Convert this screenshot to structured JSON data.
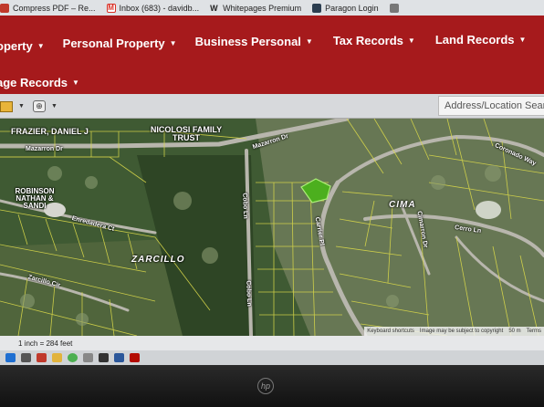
{
  "bookmarks": [
    {
      "label": "Compress PDF – Re...",
      "icon": "compress-pdf-icon",
      "color": "#c0392b"
    },
    {
      "label": "Inbox (683) - davidb...",
      "icon": "gmail-icon",
      "color": "#d93025"
    },
    {
      "label": "Whitepages Premium",
      "icon": "whitepages-icon",
      "color": "#222222"
    },
    {
      "label": "Paragon Login",
      "icon": "paragon-icon",
      "color": "#2c3e50"
    },
    {
      "label": "",
      "icon": "bookmark-icon",
      "color": "#555555"
    }
  ],
  "nav": {
    "row1": [
      "operty",
      "Personal Property",
      "Business Personal",
      "Tax Records",
      "Land Records"
    ],
    "row2": [
      "age Records"
    ],
    "brand_color": "#a61a1c"
  },
  "toolbar": {
    "search_placeholder": "Address/Location Search"
  },
  "map": {
    "owner_labels": [
      "FRAZIER, DANIEL J",
      "NICOLOSI FAMILY TRUST",
      "ROBINSON NATHAN & SANDI"
    ],
    "subdivisions": [
      "ZARCILLO",
      "CIMA"
    ],
    "streets": [
      "Mazarron Dr",
      "Mazarron Dr",
      "Enredadera Ct",
      "Zarcillo Cir",
      "Cobo Ln",
      "Cobo Ln",
      "Carrier Pl",
      "Cerro Ln",
      "Cimarron Dr",
      "Coronado Way"
    ],
    "selected_parcel_color": "#4caf1e",
    "attribution": [
      "Keyboard shortcuts",
      "Image may be subject to copyright",
      "50 m",
      "Terms"
    ]
  },
  "status": {
    "scale_text": "1 inch = 284 feet"
  },
  "taskbar_icons": [
    "windows-icon",
    "files-icon",
    "pdf-icon",
    "folder-icon",
    "chrome-icon",
    "settings-icon",
    "store-icon",
    "mail-icon",
    "acrobat-icon"
  ]
}
